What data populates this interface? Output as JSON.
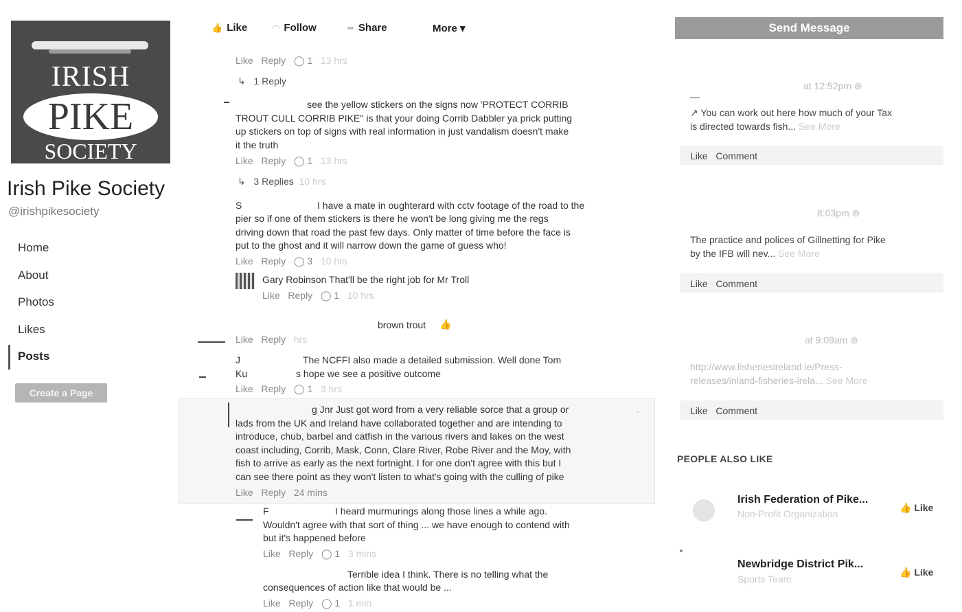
{
  "page": {
    "logo": {
      "line1": "IRISH",
      "line2": "PIKE",
      "line3": "SOCIETY"
    },
    "name": "Irish Pike Society",
    "handle": "@irishpikesociety"
  },
  "nav": {
    "home": "Home",
    "about": "About",
    "photos": "Photos",
    "likes": "Likes",
    "posts": "Posts",
    "create_page": "Create a Page"
  },
  "actions": {
    "like": "Like",
    "follow": "Follow",
    "share": "Share",
    "more": "More ▾"
  },
  "feed": {
    "c1_meta": {
      "like": "Like",
      "reply": "Reply",
      "count": "1",
      "time": "13 hrs"
    },
    "c1_replies": "1 Reply",
    "c2_lines": [
      "see the yellow stickers on the signs now 'PROTECT CORRIB",
      "TROUT CULL CORRIB PIKE'' is that your doing Corrib Dabbler ya prick putting",
      "up stickers on top of signs with real information in just vandalism doesn't make",
      "it the truth"
    ],
    "c2_meta": {
      "like": "Like",
      "reply": "Reply",
      "count": "1",
      "time": "13 hrs"
    },
    "c2_replies": "3 Replies",
    "c2_replies_time": "10 hrs",
    "c3_initial": "S",
    "c3_lines": [
      "I have a mate in oughterard with cctv footage of the road to the",
      "pier so if one of them stickers is there he won't be long giving me the regs",
      "driving down that road the past few days. Only matter of time before the face is",
      "put to the ghost and it will narrow down the game of guess who!"
    ],
    "c3_meta": {
      "like": "Like",
      "reply": "Reply",
      "count": "3",
      "time": "10 hrs"
    },
    "r1_text": "Gary Robinson That'll be the right job for Mr Troll",
    "r1_meta": {
      "like": "Like",
      "reply": "Reply",
      "count": "1",
      "time": "10 hrs"
    },
    "c4_text": "brown trout",
    "c4_meta": {
      "like": "Like",
      "reply": "Reply",
      "time": "hrs"
    },
    "c5_initial": "J",
    "c5_line1": "The NCFFI also made a detailed submission. Well done Tom",
    "c5_line2a": "Ku",
    "c5_line2b": "s hope we see a positive outcome",
    "c5_meta": {
      "like": "Like",
      "reply": "Reply",
      "count": "1",
      "time": "3 hrs"
    },
    "c6_lines": [
      "g Jnr Just got word from a very reliable sorce that a group or",
      "lads from the UK and Ireland have collaborated together and are intending to",
      "introduce, chub, barbel and catfish in the various rivers and lakes on the west",
      "coast including, Corrib, Mask, Conn, Clare River, Robe River and the Moy, with",
      "fish to arrive as early as the next fortnight. I for one don't agree with this but I",
      "can see there point as they won't listen to what's going with the culling of pike"
    ],
    "c6_meta": {
      "like": "Like",
      "reply": "Reply",
      "time": "24 mins"
    },
    "r2_initial": "F",
    "r2_lines": [
      "I heard murmurings along those lines a while ago.",
      "Wouldn't agree with that sort of thing ... we have enough to contend with",
      "but it's happened before"
    ],
    "r2_meta": {
      "like": "Like",
      "reply": "Reply",
      "count": "1",
      "time": "3 mins"
    },
    "r3_lines": [
      "Terrible idea I think. There is no telling what the",
      "consequences of action like that would be ..."
    ],
    "r3_meta": {
      "like": "Like",
      "reply": "Reply",
      "count": "1",
      "time": "1 min"
    }
  },
  "sidebar": {
    "send_message": "Send Message",
    "post1_time": "at 12:52pm",
    "post1_text_a": "You can work out here how much of your Tax",
    "post1_text_b": "is directed towards fish...",
    "post1_more": "See More",
    "post1_like": "Like",
    "post1_comment": "Comment",
    "post2_time": "8:03pm",
    "post2_text_a": "The practice and polices of Gillnetting for Pike",
    "post2_text_b": "by the IFB will nev...",
    "post2_more": "See More",
    "post2_like": "Like",
    "post2_comment": "Comment",
    "post3_time": "at 9:09am",
    "post3_text_a": "http://www.fisheriesireland.ie/Press-",
    "post3_text_b": "releases/inland-fisheries-irela...",
    "post3_more": "See More",
    "post3_like": "Like",
    "post3_comment": "Comment",
    "also_like_heading": "PEOPLE ALSO LIKE",
    "also_like": [
      {
        "name": "Irish Federation of Pike...",
        "category": "Non-Profit Organization",
        "like": "Like"
      },
      {
        "name": "Newbridge District Pik...",
        "category": "Sports Team",
        "like": "Like"
      }
    ]
  }
}
